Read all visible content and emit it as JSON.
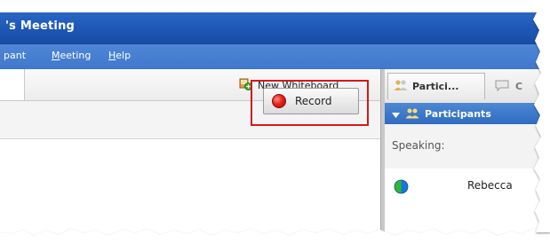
{
  "window": {
    "title": "'s Meeting"
  },
  "menu": {
    "items": [
      {
        "id": "participant",
        "label": "pant"
      },
      {
        "id": "meeting",
        "label": "Meeting"
      },
      {
        "id": "help",
        "label": "Help"
      }
    ]
  },
  "toolbar": {
    "new_whiteboard_label": "New Whiteboard"
  },
  "record": {
    "label": "Record",
    "highlight_color": "#d11a1a"
  },
  "right_panel": {
    "tabs": [
      {
        "label": "Partici...",
        "icon": "participants-icon"
      },
      {
        "label": "C",
        "icon": "chat-icon"
      }
    ],
    "participants_header": "Participants",
    "speaking_label": "Speaking:",
    "participant_name": "Rebecca"
  },
  "colors": {
    "titlebar": "#1d56b4",
    "menubar": "#4f86d6",
    "header_blue": "#2f6cc0",
    "record_red": "#e5231b"
  }
}
